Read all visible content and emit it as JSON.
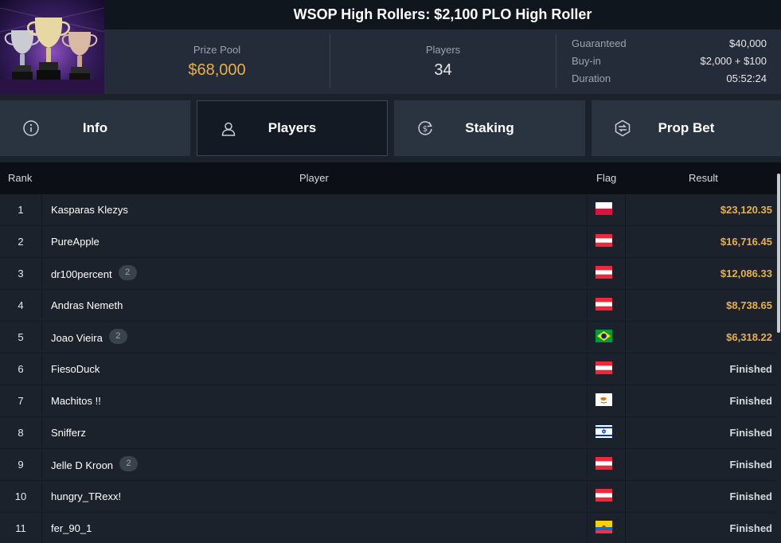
{
  "tournament": {
    "title": "WSOP High Rollers: $2,100 PLO High Roller",
    "prize_pool_label": "Prize Pool",
    "prize_pool_value": "$68,000",
    "players_label": "Players",
    "players_value": "34",
    "guaranteed_label": "Guaranteed",
    "guaranteed_value": "$40,000",
    "buyin_label": "Buy-in",
    "buyin_value": "$2,000 + $100",
    "duration_label": "Duration",
    "duration_value": "05:52:24"
  },
  "tabs": [
    {
      "label": "Info",
      "icon": "info-icon"
    },
    {
      "label": "Players",
      "icon": "user-icon"
    },
    {
      "label": "Staking",
      "icon": "dollar-refresh-icon"
    },
    {
      "label": "Prop Bet",
      "icon": "propbet-icon"
    }
  ],
  "table": {
    "headers": {
      "rank": "Rank",
      "player": "Player",
      "flag": "Flag",
      "result": "Result"
    },
    "rows": [
      {
        "rank": "1",
        "name": "Kasparas Klezys",
        "badge": "",
        "flag": "PL",
        "result": "$23,120.35",
        "money": true
      },
      {
        "rank": "2",
        "name": "PureApple",
        "badge": "",
        "flag": "AT",
        "result": "$16,716.45",
        "money": true
      },
      {
        "rank": "3",
        "name": "dr100percent",
        "badge": "2",
        "flag": "AT",
        "result": "$12,086.33",
        "money": true
      },
      {
        "rank": "4",
        "name": "Andras Nemeth",
        "badge": "",
        "flag": "AT",
        "result": "$8,738.65",
        "money": true
      },
      {
        "rank": "5",
        "name": "Joao Vieira",
        "badge": "2",
        "flag": "BR",
        "result": "$6,318.22",
        "money": true
      },
      {
        "rank": "6",
        "name": "FiesoDuck",
        "badge": "",
        "flag": "AT",
        "result": "Finished",
        "money": false
      },
      {
        "rank": "7",
        "name": "Machitos !!",
        "badge": "",
        "flag": "CY",
        "result": "Finished",
        "money": false
      },
      {
        "rank": "8",
        "name": "Snifferz",
        "badge": "",
        "flag": "IL",
        "result": "Finished",
        "money": false
      },
      {
        "rank": "9",
        "name": "Jelle D Kroon",
        "badge": "2",
        "flag": "AT",
        "result": "Finished",
        "money": false
      },
      {
        "rank": "10",
        "name": "hungry_TRexx!",
        "badge": "",
        "flag": "AT",
        "result": "Finished",
        "money": false
      },
      {
        "rank": "11",
        "name": "fer_90_1",
        "badge": "",
        "flag": "EC",
        "result": "Finished",
        "money": false
      }
    ]
  },
  "colors": {
    "money": "#e8b04a",
    "finished": "#d7dbe1",
    "accent": "#e8b04a"
  }
}
